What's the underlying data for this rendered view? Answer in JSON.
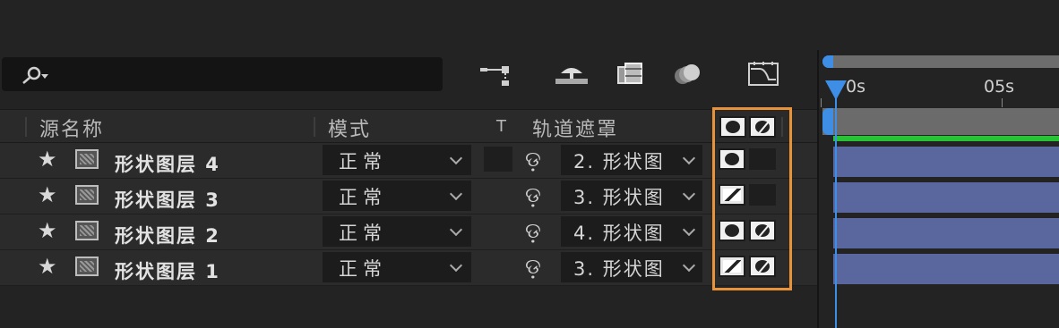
{
  "search": {
    "placeholder": ""
  },
  "toolbar": {
    "icons": [
      "flowchart-icon",
      "draft-3d-icon",
      "frame-blending-icon",
      "motion-blur-icon",
      "graph-editor-icon"
    ]
  },
  "columns": {
    "source_name": "源名称",
    "mode": "模式",
    "t": "T",
    "track_matte": "轨道遮罩"
  },
  "layers": [
    {
      "name": "形状图层 4",
      "mode": "正常",
      "matte": "2. 形状图",
      "sw1": "alpha",
      "sw2": "empty"
    },
    {
      "name": "形状图层 3",
      "mode": "正常",
      "matte": "3. 形状图",
      "sw1": "luma",
      "sw2": "empty"
    },
    {
      "name": "形状图层 2",
      "mode": "正常",
      "matte": "4. 形状图",
      "sw1": "alpha",
      "sw2": "inverted"
    },
    {
      "name": "形状图层 1",
      "mode": "正常",
      "matte": "3. 形状图",
      "sw1": "luma",
      "sw2": "inverted"
    }
  ],
  "timeline": {
    "ruler": [
      "0s",
      "05s"
    ]
  },
  "colors": {
    "accent_blue": "#3e8ee6",
    "highlight_orange": "#e8923a",
    "clip_purple": "#5a669e",
    "green_bar": "#28c236"
  }
}
